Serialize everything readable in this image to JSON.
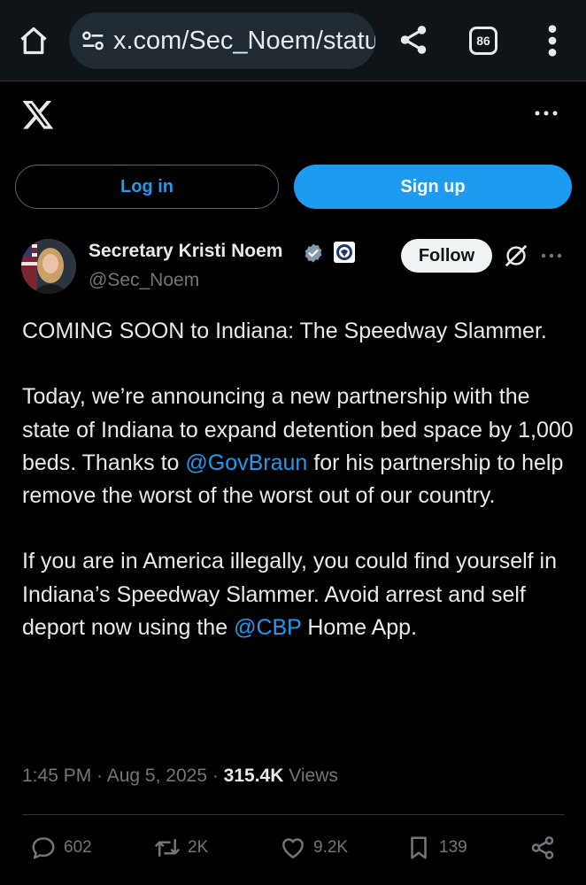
{
  "browser": {
    "url": "x.com/Sec_Noem/status",
    "tab_count": "86"
  },
  "header": {
    "login_label": "Log in",
    "signup_label": "Sign up"
  },
  "tweet": {
    "author_name": "Secretary Kristi Noem",
    "author_handle": "@Sec_Noem",
    "follow_label": "Follow",
    "p1": "COMING SOON to Indiana: The Speedway Slammer.",
    "p2_before": "Today, we’re announcing a new partnership with the state of Indiana to expand detention bed space by 1,000 beds. Thanks to ",
    "p2_mention": "@GovBraun",
    "p2_after": " for his partnership to help remove the worst of the worst out of our country.",
    "p3_before": "If you are in America illegally, you could find yourself in Indiana’s Speedway Slammer. Avoid arrest and self deport now using the ",
    "p3_mention": "@CBP",
    "p3_after": " Home App.",
    "time": "1:45 PM",
    "sep": " · ",
    "date": "Aug 5, 2025",
    "views_count": "315.4K",
    "views_label": " Views"
  },
  "actions": {
    "replies": "602",
    "reposts": "2K",
    "likes": "9.2K",
    "bookmarks": "139"
  },
  "colors": {
    "accent": "#1d9bf0",
    "background": "#000000",
    "muted": "#71767b"
  }
}
